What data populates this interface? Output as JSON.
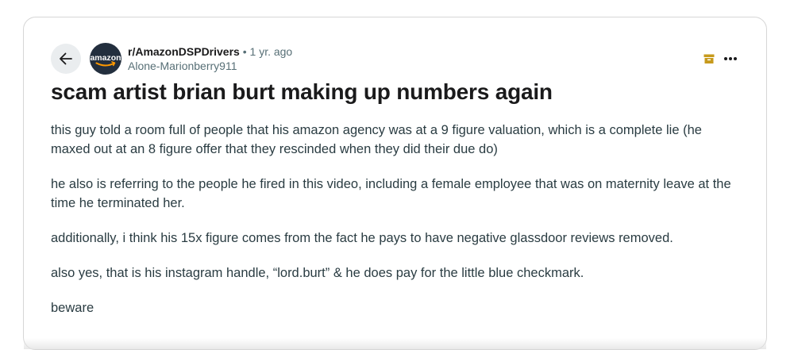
{
  "post": {
    "subreddit": "r/AmazonDSPDrivers",
    "separator": "•",
    "age": "1 yr. ago",
    "author": "Alone-Marionberry911",
    "avatar_text": "amazon",
    "title": "scam artist brian burt making up numbers again",
    "paragraphs": [
      "this guy told a room full of people that his amazon agency was at a 9 figure valuation, which is a complete lie (he maxed out at an 8 figure offer that they rescinded when they did their due do)",
      "he also is referring to the people he fired in this video, including a female employee that was on maternity leave at the time he terminated her.",
      "additionally, i think his 15x figure comes from the fact he pays to have negative glassdoor reviews removed.",
      "also yes, that is his instagram handle, “lord.burt” & he does pay for the little blue checkmark.",
      "beware"
    ]
  },
  "icons": {
    "back": "arrow-left-icon",
    "archive": "archive-icon",
    "more": "more-horizontal-icon"
  },
  "colors": {
    "avatar_bg": "#232f3e",
    "amazon_orange": "#ff9900",
    "archive": "#c79a1c",
    "meta_gray": "#576f76",
    "back_button_bg": "#eaedef"
  }
}
